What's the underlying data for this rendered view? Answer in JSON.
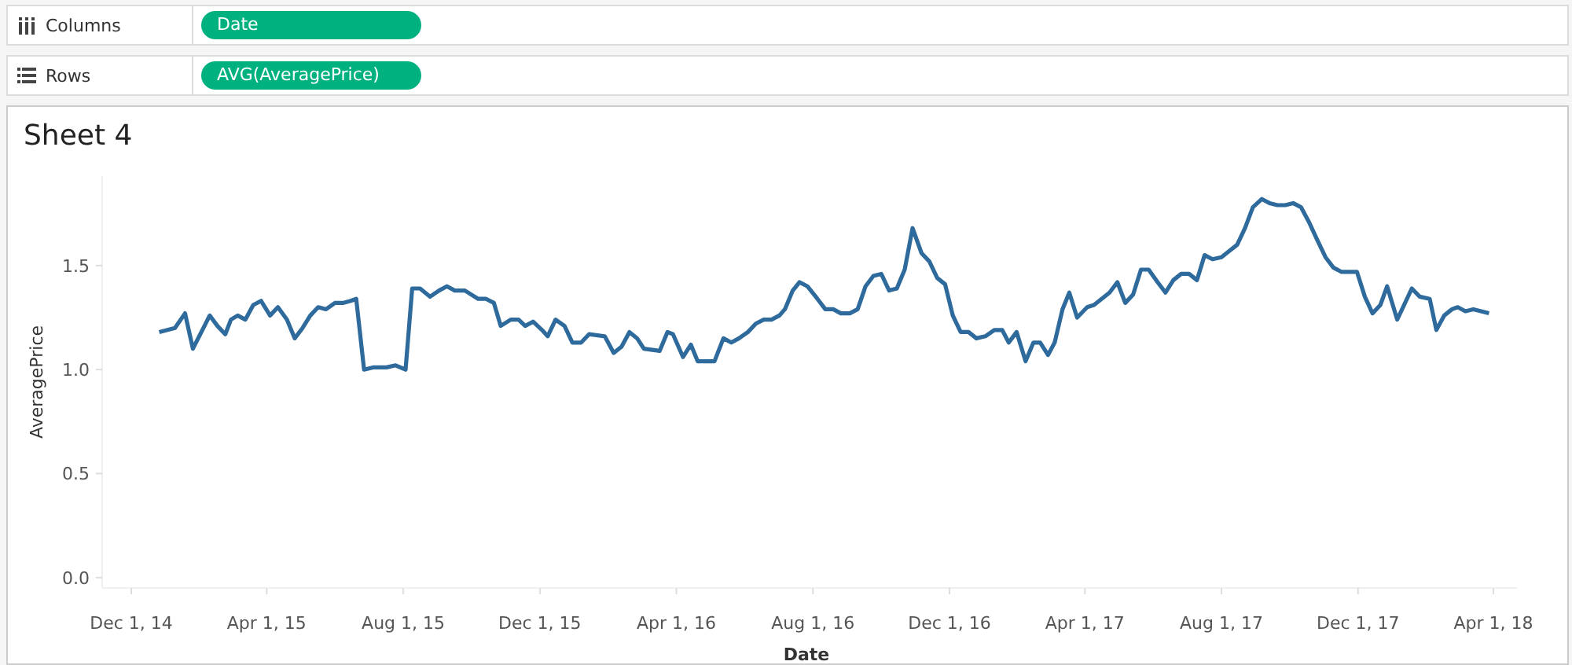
{
  "shelves": [
    {
      "kind": "columns",
      "label": "Columns",
      "pill": "Date"
    },
    {
      "kind": "rows",
      "label": "Rows",
      "pill": "AVG(AveragePrice)"
    }
  ],
  "sheet": {
    "title": "Sheet 4",
    "chart_data": {
      "type": "line",
      "xlabel": "Date",
      "ylabel": "AveragePrice",
      "xlim": [
        "2014-11-05",
        "2018-04-22"
      ],
      "ylim": [
        -0.05,
        1.93
      ],
      "xticks": [
        {
          "value": "2014-12-01",
          "label": "Dec 1, 14"
        },
        {
          "value": "2015-04-01",
          "label": "Apr 1, 15"
        },
        {
          "value": "2015-08-01",
          "label": "Aug 1, 15"
        },
        {
          "value": "2015-12-01",
          "label": "Dec 1, 15"
        },
        {
          "value": "2016-04-01",
          "label": "Apr 1, 16"
        },
        {
          "value": "2016-08-01",
          "label": "Aug 1, 16"
        },
        {
          "value": "2016-12-01",
          "label": "Dec 1, 16"
        },
        {
          "value": "2017-04-01",
          "label": "Apr 1, 17"
        },
        {
          "value": "2017-08-01",
          "label": "Aug 1, 17"
        },
        {
          "value": "2017-12-01",
          "label": "Dec 1, 17"
        },
        {
          "value": "2018-04-01",
          "label": "Apr 1, 18"
        }
      ],
      "yticks": [
        {
          "value": 0,
          "label": "0.0"
        },
        {
          "value": 0.5,
          "label": "0.5"
        },
        {
          "value": 1,
          "label": "1.0"
        },
        {
          "value": 1.5,
          "label": "1.5"
        }
      ],
      "x": [
        "2014-12-26",
        "2015-01-09",
        "2015-01-18",
        "2015-01-25",
        "2015-02-09",
        "2015-02-16",
        "2015-02-23",
        "2015-02-28",
        "2015-03-06",
        "2015-03-13",
        "2015-03-20",
        "2015-03-27",
        "2015-04-04",
        "2015-04-11",
        "2015-04-19",
        "2015-04-26",
        "2015-05-03",
        "2015-05-10",
        "2015-05-17",
        "2015-05-24",
        "2015-06-01",
        "2015-06-08",
        "2015-06-15",
        "2015-06-20",
        "2015-06-27",
        "2015-07-05",
        "2015-07-17",
        "2015-07-25",
        "2015-08-03",
        "2015-08-09",
        "2015-08-16",
        "2015-08-25",
        "2015-09-02",
        "2015-09-09",
        "2015-09-16",
        "2015-09-25",
        "2015-10-07",
        "2015-10-14",
        "2015-10-21",
        "2015-10-27",
        "2015-11-05",
        "2015-11-12",
        "2015-11-18",
        "2015-11-25",
        "2015-12-03",
        "2015-12-08",
        "2015-12-15",
        "2015-12-23",
        "2015-12-30",
        "2016-01-07",
        "2016-01-14",
        "2016-01-28",
        "2016-02-05",
        "2016-02-12",
        "2016-02-19",
        "2016-02-26",
        "2016-03-03",
        "2016-03-17",
        "2016-03-24",
        "2016-03-29",
        "2016-04-07",
        "2016-04-14",
        "2016-04-20",
        "2016-05-05",
        "2016-05-13",
        "2016-05-20",
        "2016-05-27",
        "2016-06-04",
        "2016-06-11",
        "2016-06-18",
        "2016-06-25",
        "2016-07-02",
        "2016-07-07",
        "2016-07-14",
        "2016-07-20",
        "2016-07-27",
        "2016-08-05",
        "2016-08-12",
        "2016-08-19",
        "2016-08-26",
        "2016-09-03",
        "2016-09-10",
        "2016-09-17",
        "2016-09-24",
        "2016-10-01",
        "2016-10-08",
        "2016-10-15",
        "2016-10-22",
        "2016-10-29",
        "2016-11-06",
        "2016-11-13",
        "2016-11-20",
        "2016-11-27",
        "2016-12-04",
        "2016-12-11",
        "2016-12-18",
        "2016-12-25",
        "2017-01-02",
        "2017-01-10",
        "2017-01-17",
        "2017-01-23",
        "2017-01-30",
        "2017-02-07",
        "2017-02-14",
        "2017-02-20",
        "2017-02-27",
        "2017-03-05",
        "2017-03-12",
        "2017-03-18",
        "2017-03-25",
        "2017-04-03",
        "2017-04-09",
        "2017-04-16",
        "2017-04-23",
        "2017-04-30",
        "2017-05-07",
        "2017-05-14",
        "2017-05-21",
        "2017-05-28",
        "2017-06-05",
        "2017-06-12",
        "2017-06-19",
        "2017-06-26",
        "2017-07-03",
        "2017-07-10",
        "2017-07-17",
        "2017-07-24",
        "2017-08-01",
        "2017-08-08",
        "2017-08-15",
        "2017-08-22",
        "2017-08-29",
        "2017-09-06",
        "2017-09-13",
        "2017-09-20",
        "2017-09-27",
        "2017-10-04",
        "2017-10-11",
        "2017-10-18",
        "2017-10-25",
        "2017-11-02",
        "2017-11-09",
        "2017-11-16",
        "2017-11-23",
        "2017-11-30",
        "2017-12-07",
        "2017-12-14",
        "2017-12-21",
        "2017-12-27",
        "2018-01-05",
        "2018-01-12",
        "2018-01-18",
        "2018-01-25",
        "2018-02-03",
        "2018-02-09",
        "2018-02-16",
        "2018-02-23",
        "2018-02-28",
        "2018-03-07",
        "2018-03-14",
        "2018-03-21",
        "2018-03-28"
      ],
      "series": [
        {
          "color": "#2e6a9c",
          "values": [
            1.18,
            1.2,
            1.27,
            1.1,
            1.26,
            1.21,
            1.17,
            1.24,
            1.26,
            1.24,
            1.31,
            1.33,
            1.26,
            1.3,
            1.24,
            1.15,
            1.2,
            1.26,
            1.3,
            1.29,
            1.32,
            1.32,
            1.33,
            1.34,
            1.0,
            1.01,
            1.01,
            1.02,
            1.0,
            1.39,
            1.39,
            1.35,
            1.38,
            1.4,
            1.38,
            1.38,
            1.34,
            1.34,
            1.32,
            1.21,
            1.24,
            1.24,
            1.21,
            1.23,
            1.19,
            1.16,
            1.24,
            1.21,
            1.13,
            1.13,
            1.17,
            1.16,
            1.08,
            1.11,
            1.18,
            1.15,
            1.1,
            1.09,
            1.18,
            1.17,
            1.06,
            1.12,
            1.04,
            1.04,
            1.15,
            1.13,
            1.15,
            1.18,
            1.22,
            1.24,
            1.24,
            1.26,
            1.29,
            1.38,
            1.42,
            1.4,
            1.34,
            1.29,
            1.29,
            1.27,
            1.27,
            1.29,
            1.4,
            1.45,
            1.46,
            1.38,
            1.39,
            1.48,
            1.68,
            1.56,
            1.52,
            1.44,
            1.41,
            1.26,
            1.18,
            1.18,
            1.15,
            1.16,
            1.19,
            1.19,
            1.13,
            1.18,
            1.04,
            1.13,
            1.13,
            1.07,
            1.13,
            1.29,
            1.37,
            1.25,
            1.3,
            1.31,
            1.34,
            1.37,
            1.42,
            1.32,
            1.36,
            1.48,
            1.48,
            1.42,
            1.37,
            1.43,
            1.46,
            1.46,
            1.43,
            1.55,
            1.53,
            1.54,
            1.57,
            1.6,
            1.68,
            1.78,
            1.82,
            1.8,
            1.79,
            1.79,
            1.8,
            1.78,
            1.71,
            1.63,
            1.54,
            1.49,
            1.47,
            1.47,
            1.47,
            1.35,
            1.27,
            1.31,
            1.4,
            1.24,
            1.32,
            1.39,
            1.35,
            1.34,
            1.19,
            1.26,
            1.29,
            1.3,
            1.28,
            1.29,
            1.28,
            1.27
          ]
        }
      ]
    }
  }
}
